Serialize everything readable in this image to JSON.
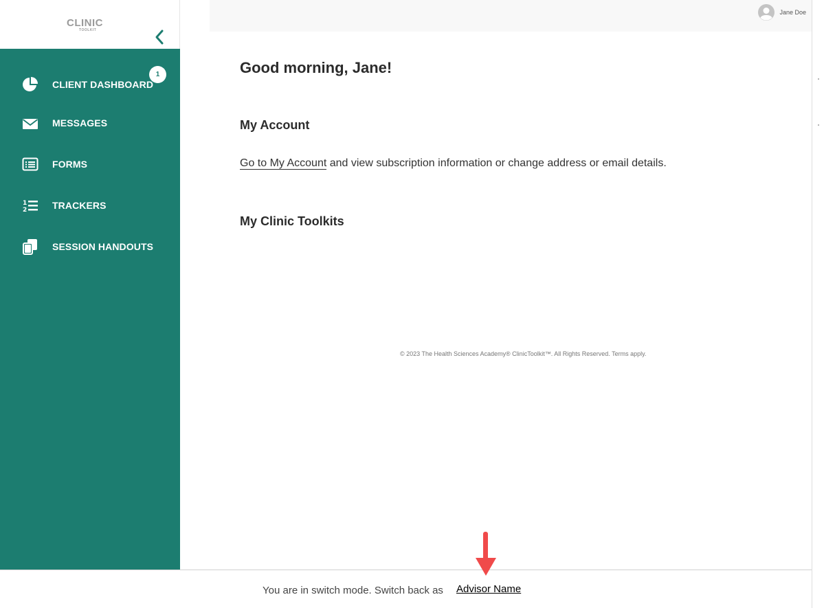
{
  "logo": {
    "main": "CLINIC",
    "sub": "TOOLKIT"
  },
  "sidebar": {
    "items": [
      {
        "label": "CLIENT DASHBOARD",
        "icon": "pie-chart-icon"
      },
      {
        "label": "MESSAGES",
        "icon": "envelope-icon",
        "badge": "1"
      },
      {
        "label": "FORMS",
        "icon": "list-form-icon"
      },
      {
        "label": "TRACKERS",
        "icon": "numbered-list-icon"
      },
      {
        "label": "SESSION HANDOUTS",
        "icon": "copy-documents-icon"
      }
    ]
  },
  "header": {
    "user_name": "Jane Doe"
  },
  "main": {
    "greeting": "Good morning, Jane!",
    "account_heading": "My Account",
    "account_link": "Go to My Account",
    "account_text": " and view subscription information or change address or email details.",
    "toolkits_heading": "My Clinic Toolkits",
    "footer": "© 2023 The Health Sciences Academy® ClinicToolkit™. All Rights Reserved. Terms apply."
  },
  "switch_mode": {
    "text": "You are in switch mode. Switch back as",
    "link": "Advisor Name"
  },
  "colors": {
    "sidebar": "#1c7d70",
    "annotation_arrow": "#f04a4a"
  }
}
